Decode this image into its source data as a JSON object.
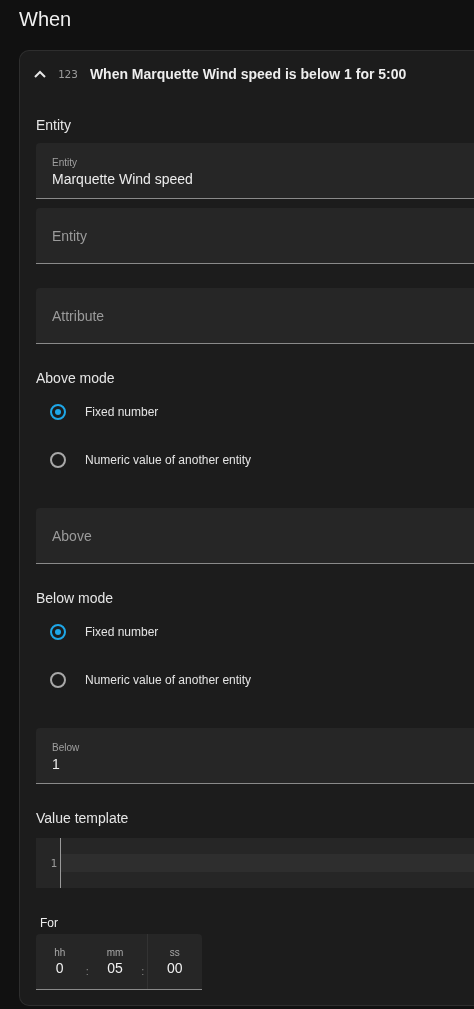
{
  "title": "When",
  "trigger": {
    "expanded": true,
    "icon_label": "123",
    "summary": "When Marquette Wind speed is below 1 for 5:00"
  },
  "sections": [
    {
      "kind": "heading",
      "text": "Entity"
    },
    {
      "kind": "field",
      "label": "Entity",
      "value": "Marquette Wind speed"
    },
    {
      "kind": "field",
      "label": "Entity"
    },
    {
      "kind": "field",
      "label": "Attribute"
    },
    {
      "kind": "heading",
      "text": "Above mode"
    },
    {
      "kind": "radio",
      "options": [
        {
          "label": "Fixed number",
          "selected": true
        },
        {
          "label": "Numeric value of another entity",
          "selected": false
        }
      ]
    },
    {
      "kind": "field",
      "label": "Above"
    },
    {
      "kind": "heading",
      "text": "Below mode"
    },
    {
      "kind": "radio",
      "options": [
        {
          "label": "Fixed number",
          "selected": true
        },
        {
          "label": "Numeric value of another entity",
          "selected": false
        }
      ]
    },
    {
      "kind": "field",
      "label": "Below",
      "value": "1"
    },
    {
      "kind": "heading",
      "text": "Value template"
    },
    {
      "kind": "code",
      "line_number": "1"
    },
    {
      "kind": "duration",
      "label": "For",
      "units": [
        {
          "label": "hh",
          "value": "0"
        },
        {
          "label": "mm",
          "value": "05"
        },
        {
          "label": "ss",
          "value": "00"
        }
      ],
      "separators": [
        ":",
        ":"
      ]
    }
  ]
}
